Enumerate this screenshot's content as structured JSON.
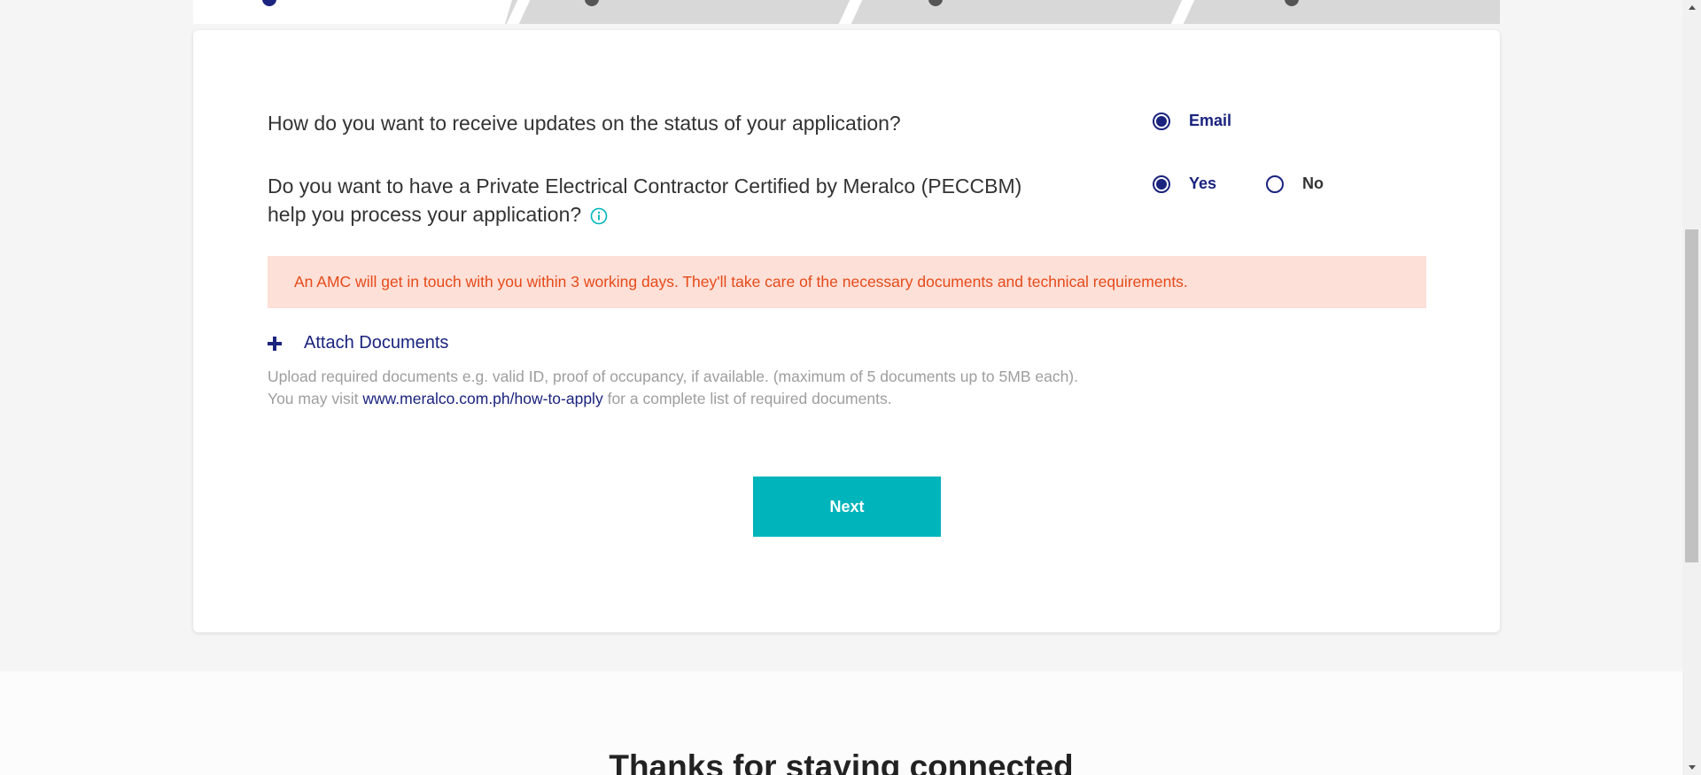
{
  "colors": {
    "primary": "#1a237e",
    "accent": "#00b4bc",
    "notice_bg": "#fde0d8",
    "notice_text": "#e64a19",
    "muted_text": "#9e9e9e"
  },
  "stepper": {
    "steps": 4,
    "active_step": 1
  },
  "form": {
    "updates_question": "How do you want to receive updates on the status of your application?",
    "updates_options": [
      {
        "label": "Email",
        "selected": true
      }
    ],
    "peccbm_question_line1": "Do you want to have a Private Electrical Contractor Certified by Meralco (PECCBM)",
    "peccbm_question_line2": "help you process your application?",
    "peccbm_options": [
      {
        "label": "Yes",
        "selected": true
      },
      {
        "label": "No",
        "selected": false
      }
    ],
    "notice": "An AMC will get in touch with you within 3 working days. They'll take care of the necessary documents and technical requirements.",
    "attach_label": "Attach Documents",
    "help_line1": "Upload required documents e.g. valid ID, proof of occupancy, if available. (maximum of 5 documents up to 5MB each).",
    "help_line2_prefix": "You may visit",
    "help_link": "www.meralco.com.ph/how-to-apply",
    "help_line2_suffix": "for a complete list of required documents.",
    "next_label": "Next"
  },
  "footer": {
    "heading": "Thanks for staying connected"
  }
}
